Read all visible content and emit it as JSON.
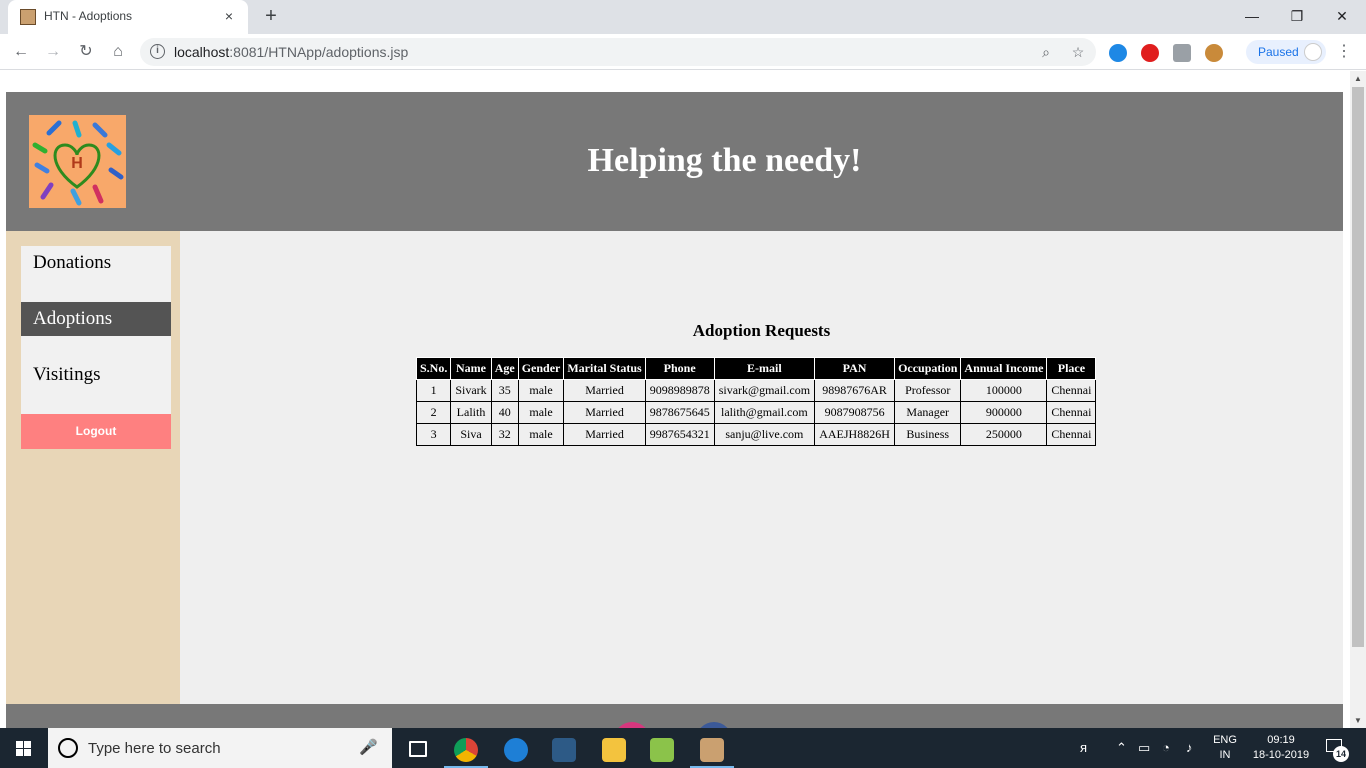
{
  "browser": {
    "tab_title": "HTN - Adoptions",
    "new_tab_glyph": "+",
    "tab_close_glyph": "×",
    "window_controls": {
      "minimize": "—",
      "restore": "❐",
      "close": "✕"
    },
    "url_host": "localhost",
    "url_rest": ":8081/HTNApp/adoptions.jsp",
    "paused_label": "Paused",
    "nav_glyphs": {
      "back": "←",
      "forward": "→",
      "reload": "↻",
      "home": "⌂"
    }
  },
  "site": {
    "title": "Helping the needy!",
    "logo_letter": "H"
  },
  "sidebar": {
    "items": [
      {
        "label": "Donations"
      },
      {
        "label": "Adoptions"
      },
      {
        "label": "Visitings"
      }
    ],
    "logout_label": "Logout"
  },
  "main": {
    "heading": "Adoption Requests",
    "columns": [
      "S.No.",
      "Name",
      "Age",
      "Gender",
      "Marital Status",
      "Phone",
      "E-mail",
      "PAN",
      "Occupation",
      "Annual Income",
      "Place"
    ],
    "rows": [
      [
        "1",
        "Sivark",
        "35",
        "male",
        "Married",
        "9098989878",
        "sivark@gmail.com",
        "98987676AR",
        "Professor",
        "100000",
        "Chennai"
      ],
      [
        "2",
        "Lalith",
        "40",
        "male",
        "Married",
        "9878675645",
        "lalith@gmail.com",
        "9087908756",
        "Manager",
        "900000",
        "Chennai"
      ],
      [
        "3",
        "Siva",
        "32",
        "male",
        "Married",
        "9987654321",
        "sanju@live.com",
        "AAEJH8826H",
        "Business",
        "250000",
        "Chennai"
      ]
    ]
  },
  "taskbar": {
    "search_placeholder": "Type here to search",
    "lang_top": "ENG",
    "lang_bottom": "IN",
    "time": "09:19",
    "date": "18-10-2019",
    "notification_count": "14"
  },
  "colors": {
    "header_bg": "#787878",
    "sidebar_bg": "#e8d6b7",
    "active_item_bg": "#545454",
    "logout_bg": "#fe8080",
    "content_bg": "#efefef"
  }
}
